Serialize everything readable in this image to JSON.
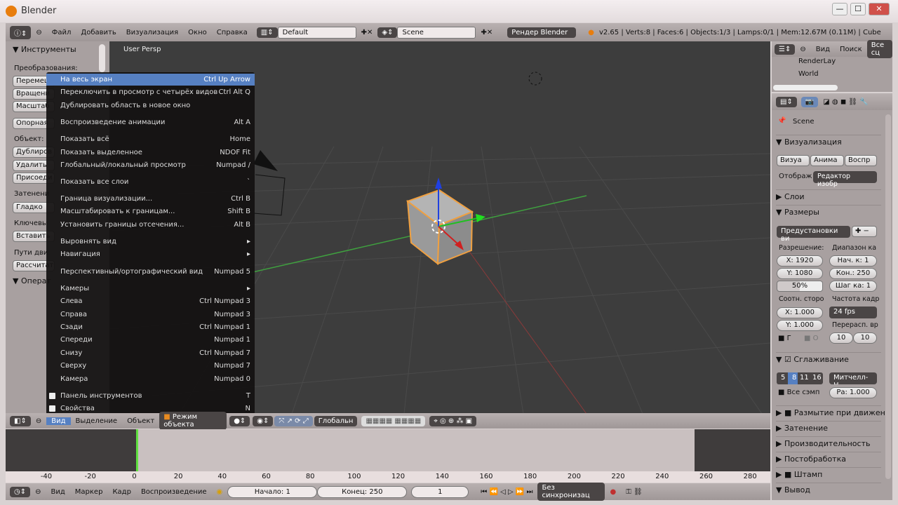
{
  "window": {
    "title": "Blender",
    "minimize": "—",
    "maximize": "☐",
    "close": "✕"
  },
  "info_header": {
    "menus": [
      "Файл",
      "Добавить",
      "Визуализация",
      "Окно",
      "Справка"
    ],
    "layout": "Default",
    "scene": "Scene",
    "engine": "Рендер Blender",
    "stats": "v2.65 | Verts:8 | Faces:6 | Objects:1/3 | Lamps:0/1 | Mem:12.67M (0.11M) | Cube"
  },
  "tools_panel": {
    "title": "Инструменты",
    "sections": [
      {
        "label": "Преобразования:",
        "buttons": [
          "Перемещ",
          "Вращени",
          "Масштаб"
        ]
      },
      {
        "label": "",
        "buttons": [
          "Опорная"
        ]
      },
      {
        "label": "Объект:",
        "buttons": [
          "Дублиров",
          "Удалить",
          "Присоеди"
        ]
      },
      {
        "label": "Затенени",
        "buttons": [
          "Гладко"
        ]
      },
      {
        "label": "Ключевы",
        "buttons": [
          "Вставить"
        ]
      },
      {
        "label": "Пути дви",
        "buttons": [
          "Рассчитат"
        ]
      }
    ],
    "operator": "Операт"
  },
  "viewport": {
    "label": "User Persp"
  },
  "view_menu": {
    "items": [
      {
        "label": "На весь экран",
        "shortcut": "Ctrl Up Arrow",
        "highlighted": true
      },
      {
        "label": "Переключить в просмотр с четырёх видов",
        "shortcut": "Ctrl Alt Q"
      },
      {
        "label": "Дублировать область в новое окно",
        "shortcut": ""
      },
      {
        "label": "Воспроизведение анимации",
        "shortcut": "Alt A"
      },
      {
        "label": "Показать всё",
        "shortcut": "Home"
      },
      {
        "label": "Показать выделенное",
        "shortcut": "NDOF Fit"
      },
      {
        "label": "Глобальный/локальный просмотр",
        "shortcut": "Numpad /"
      },
      {
        "label": "Показать все слои",
        "shortcut": "`"
      },
      {
        "label": "Граница визуализации...",
        "shortcut": "Ctrl B"
      },
      {
        "label": "Масштабировать к границам...",
        "shortcut": "Shift B"
      },
      {
        "label": "Установить границы отсечения...",
        "shortcut": "Alt B"
      },
      {
        "label": "Выровнять вид",
        "shortcut": "▸"
      },
      {
        "label": "Навигация",
        "shortcut": "▸"
      },
      {
        "label": "Перспективный/ортографический вид",
        "shortcut": "Numpad 5"
      },
      {
        "label": "Камеры",
        "shortcut": "▸"
      },
      {
        "label": "Слева",
        "shortcut": "Ctrl Numpad 3"
      },
      {
        "label": "Справа",
        "shortcut": "Numpad 3"
      },
      {
        "label": "Сзади",
        "shortcut": "Ctrl Numpad 1"
      },
      {
        "label": "Спереди",
        "shortcut": "Numpad 1"
      },
      {
        "label": "Снизу",
        "shortcut": "Ctrl Numpad 7"
      },
      {
        "label": "Сверху",
        "shortcut": "Numpad 7"
      },
      {
        "label": "Камера",
        "shortcut": "Numpad 0"
      },
      {
        "label": "Панель инструментов",
        "shortcut": "T",
        "checkbox": true
      },
      {
        "label": "Свойства",
        "shortcut": "N",
        "checkbox": true
      }
    ]
  },
  "view3d_header": {
    "menus": [
      "Вид",
      "Выделение",
      "Объект"
    ],
    "mode": "Режим объекта",
    "orientation": "Глобальн"
  },
  "timeline": {
    "ticks": [
      "-40",
      "-20",
      "0",
      "20",
      "40",
      "60",
      "80",
      "100",
      "120",
      "140",
      "160",
      "180",
      "200",
      "220",
      "240",
      "260",
      "280"
    ],
    "current_frame": "1",
    "menus": [
      "Вид",
      "Маркер",
      "Кадр",
      "Воспроизведение"
    ],
    "start": "Начало: 1",
    "end": "Конец: 250",
    "sync": "Без синхронизац"
  },
  "outliner": {
    "menus": [
      "Вид",
      "Поиск"
    ],
    "filter": "Все сц",
    "items": [
      "RenderLay",
      "World"
    ]
  },
  "properties": {
    "scene": "Scene",
    "render": {
      "title": "Визуализация",
      "buttons": [
        "Визуа",
        "Анима",
        "Воспр"
      ],
      "display_label": "Отображ",
      "display": "Редактор изобр"
    },
    "layers": "Слои",
    "dimensions": {
      "title": "Размеры",
      "presets": "Предустановки ви",
      "resolution": "Разрешение:",
      "res_x": "X: 1920",
      "res_y": "Y: 1080",
      "percent": "50%",
      "frame_range": "Диапазон ка",
      "start": "Нач. к: 1",
      "end": "Кон.: 250",
      "step": "Шаг ка: 1",
      "aspect": "Соотн. сторо",
      "asp_x": "X: 1.000",
      "asp_y": "Y: 1.000",
      "fps_label": "Частота кадр",
      "fps": "24 fps",
      "remap": "Перерасп. вр",
      "remap_old": "10",
      "remap_new": "10",
      "border": "Г",
      "crop": "О"
    },
    "aa": {
      "title": "Сглаживание",
      "samples": [
        "5",
        "8",
        "11",
        "16"
      ],
      "selected": "8",
      "filter": "Митчелл-Н",
      "full": "Все сэмп",
      "size": "Ра: 1.000"
    },
    "collapsed": [
      "Размытие при движен",
      "Затенение",
      "Производительность",
      "Постобработка",
      "Штамп"
    ],
    "output": "Вывод"
  },
  "colors": {
    "menu_highlight": "#5680c2",
    "viewport_bg": "#3d3d3d",
    "current_frame": "#60e040"
  }
}
